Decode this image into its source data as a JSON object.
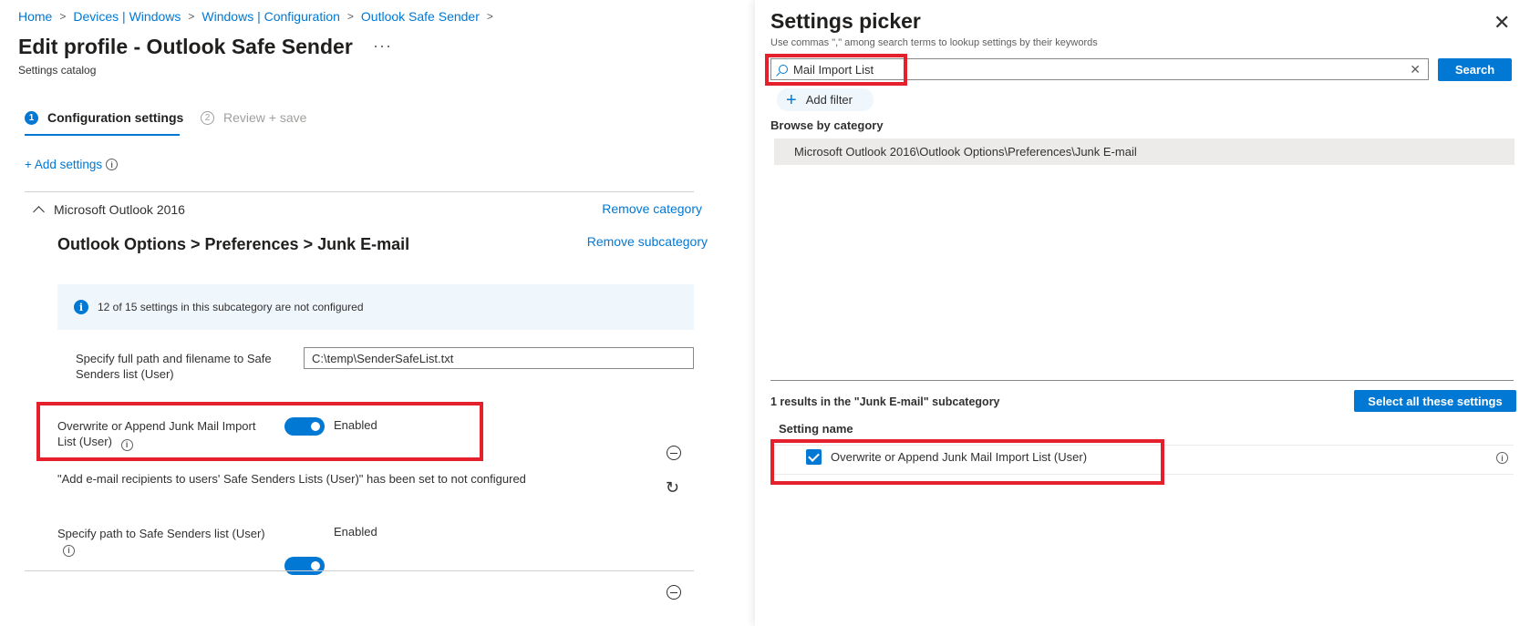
{
  "breadcrumb": [
    "Home",
    "Devices | Windows",
    "Windows | Configuration",
    "Outlook Safe Sender"
  ],
  "page": {
    "title": "Edit profile - Outlook Safe Sender",
    "more": "···",
    "subtitle": "Settings catalog"
  },
  "steps": [
    {
      "number": "1",
      "label": "Configuration settings",
      "active": true
    },
    {
      "number": "2",
      "label": "Review + save",
      "active": false
    }
  ],
  "add_settings": "+ Add settings",
  "category": {
    "name": "Microsoft Outlook 2016",
    "remove_label": "Remove category",
    "subcategory": "Outlook Options > Preferences > Junk E-mail",
    "remove_sub_label": "Remove subcategory",
    "info_text": "12 of 15 settings in this subcategory are not configured"
  },
  "settings": {
    "path": {
      "label": "Specify full path and filename to Safe Senders list (User)",
      "value": "C:\\temp\\SenderSafeList.txt"
    },
    "overwrite": {
      "label": "Overwrite or Append Junk Mail Import List (User)",
      "state": "Enabled"
    },
    "not_configured_text": "\"Add e-mail recipients to users' Safe Senders Lists (User)\" has been set to not configured",
    "safe_path": {
      "label": "Specify path to Safe Senders list (User)",
      "state": "Enabled"
    }
  },
  "picker": {
    "title": "Settings picker",
    "subtitle": "Use commas \",\" among search terms to lookup settings by their keywords",
    "search_value": "Mail Import List",
    "search_button": "Search",
    "add_filter": "Add filter",
    "browse_label": "Browse by category",
    "category_row": "Microsoft Outlook 2016\\Outlook Options\\Preferences\\Junk E-mail",
    "results_label": "1 results in the \"Junk E-mail\" subcategory",
    "select_all": "Select all these settings",
    "column_header": "Setting name",
    "results": [
      {
        "name": "Overwrite or Append Junk Mail Import List (User)",
        "checked": true
      }
    ]
  },
  "colors": {
    "accent": "#0078d4",
    "highlight": "#e3202b"
  }
}
